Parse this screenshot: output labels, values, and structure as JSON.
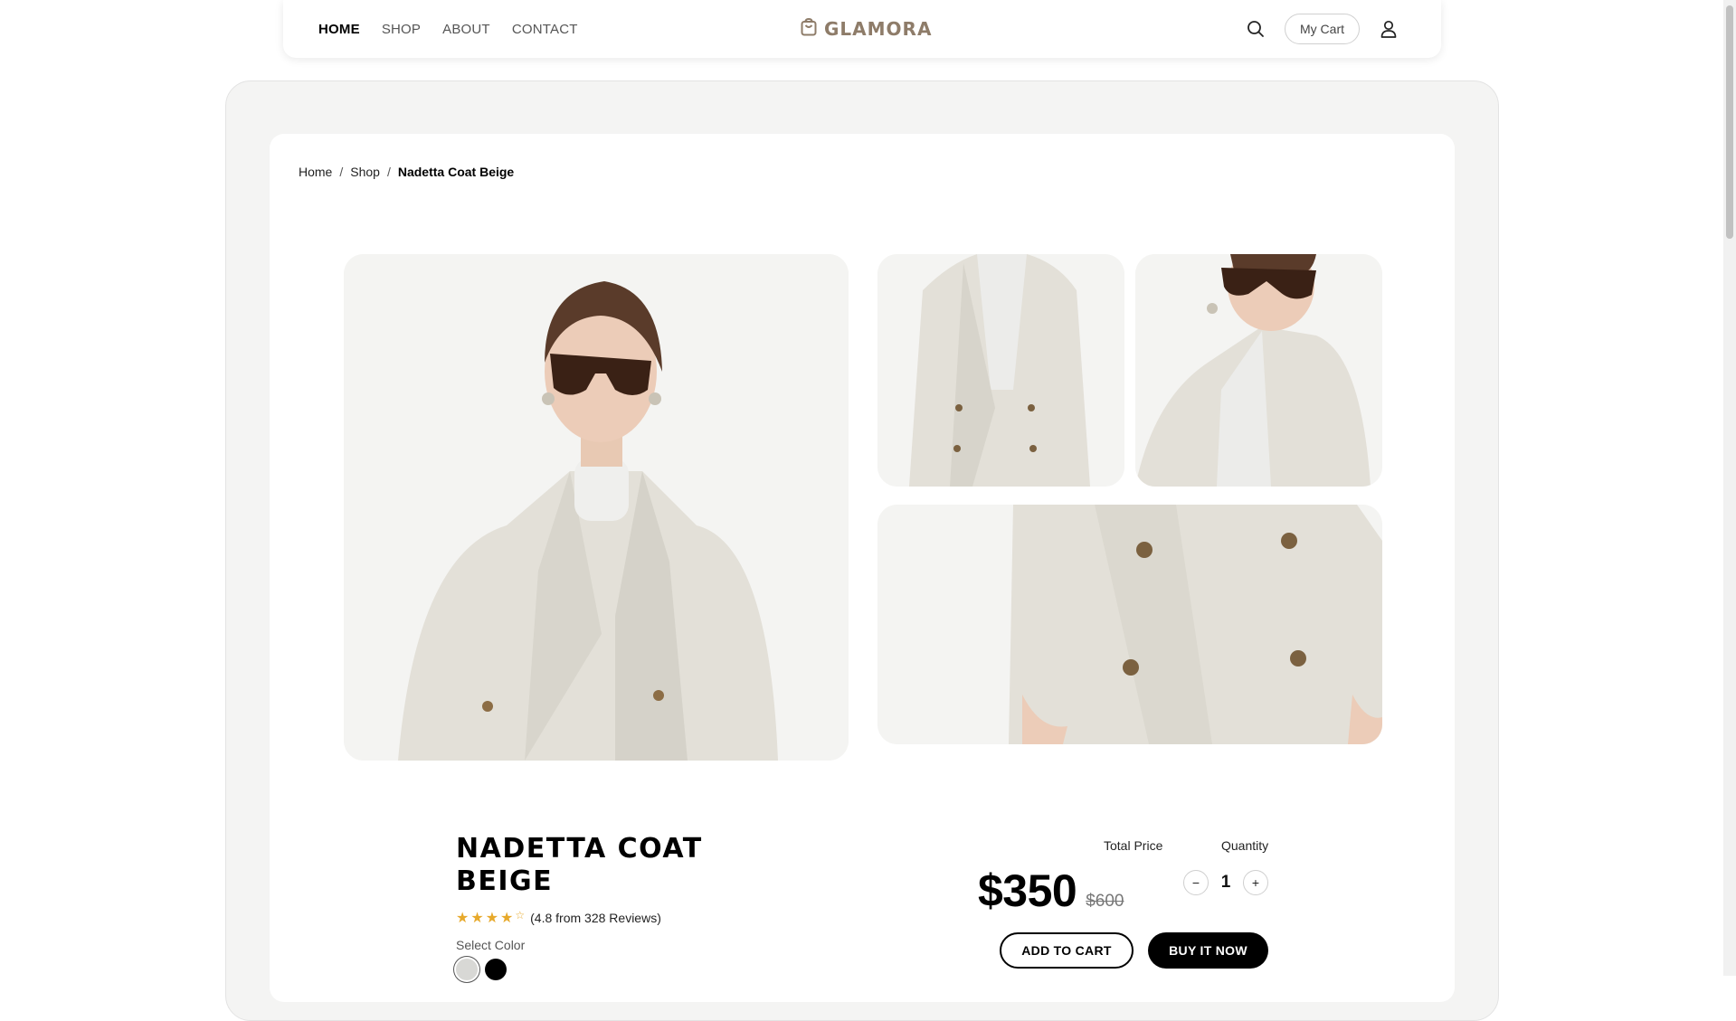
{
  "nav": {
    "links": [
      {
        "label": "HOME",
        "active": true
      },
      {
        "label": "SHOP",
        "active": false
      },
      {
        "label": "ABOUT",
        "active": false
      },
      {
        "label": "CONTACT",
        "active": false
      }
    ],
    "brand": "GLAMORA",
    "brand_icon": "shopping-bag-icon",
    "search_icon": "search-icon",
    "cart_label": "My Cart",
    "user_icon": "user-icon",
    "brand_color": "#8e7c69"
  },
  "breadcrumb": {
    "home": "Home",
    "shop": "Shop",
    "current": "Nadetta Coat Beige",
    "separator": "/"
  },
  "product": {
    "title": "NADETTA COAT BEIGE",
    "rating_value": 4.8,
    "rating_text": "(4.8 from 328 Reviews)",
    "select_color_label": "Select Color",
    "colors": [
      "#d8d8d5",
      "#000000"
    ],
    "total_price_label": "Total Price",
    "quantity_label": "Quantity",
    "price": "$350",
    "old_price": "$600",
    "quantity": "1",
    "minus_label": "−",
    "plus_label": "+",
    "add_to_cart": "ADD TO CART",
    "buy_now": "BUY IT NOW",
    "star_color": "#e7a92b"
  }
}
